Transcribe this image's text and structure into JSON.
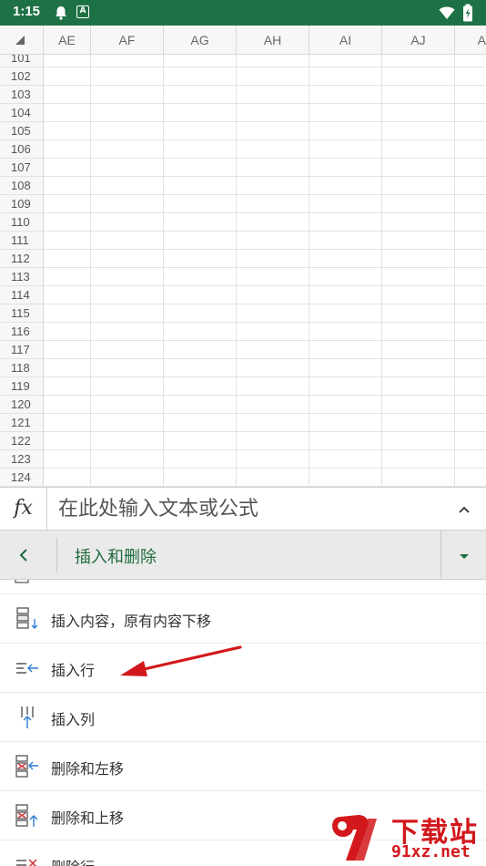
{
  "status_bar": {
    "time": "1:15",
    "icons": [
      "notification-bell-icon",
      "a-app-icon",
      "wifi-icon",
      "battery-charging-icon"
    ],
    "a_label": "A"
  },
  "grid": {
    "columns": [
      "AE",
      "AF",
      "AG",
      "AH",
      "AI",
      "AJ",
      "A"
    ],
    "rows": [
      "101",
      "102",
      "103",
      "104",
      "105",
      "106",
      "107",
      "108",
      "109",
      "110",
      "111",
      "112",
      "113",
      "114",
      "115",
      "116",
      "117",
      "118",
      "119",
      "120",
      "121",
      "122",
      "123",
      "124"
    ]
  },
  "formula_bar": {
    "fx_label": "fx",
    "placeholder": "在此处输入文本或公式"
  },
  "menu_header": {
    "title": "插入和删除"
  },
  "menu": {
    "items": [
      {
        "label": "插入内容，原有内容下移",
        "icon": "insert-shift-down-icon"
      },
      {
        "label": "插入行",
        "icon": "insert-row-icon"
      },
      {
        "label": "插入列",
        "icon": "insert-column-icon"
      },
      {
        "label": "删除和左移",
        "icon": "delete-shift-left-icon"
      },
      {
        "label": "删除和上移",
        "icon": "delete-shift-up-icon"
      },
      {
        "label": "删除行",
        "icon": "delete-row-icon"
      }
    ]
  },
  "watermark": {
    "title": "下载站",
    "url": "91xz.net"
  },
  "colors": {
    "status_green": "#1e7145",
    "header_green_text": "#1e6b3f",
    "icon_blue": "#2b7cd3",
    "delete_red": "#d13438",
    "annotation_red": "#d2181c"
  }
}
